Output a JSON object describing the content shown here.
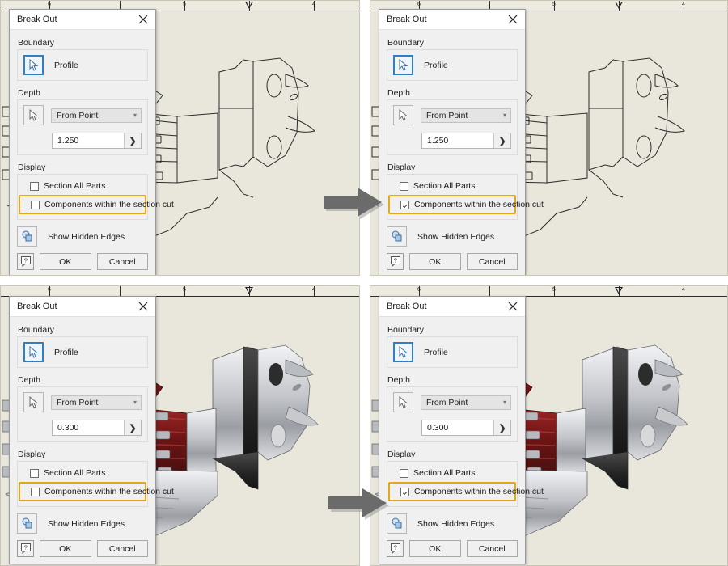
{
  "app": {
    "dialog_title": "Break Out",
    "close_icon": "close-icon"
  },
  "ruler": {
    "labels": [
      "6",
      "5",
      "4"
    ],
    "marker_icon": "down-triangle-marker"
  },
  "dialog": {
    "boundary": {
      "group_label": "Boundary",
      "profile_label": "Profile",
      "profile_icon": "select-arrow-icon"
    },
    "depth": {
      "group_label": "Depth",
      "point_icon": "select-arrow-icon",
      "method_value": "From Point",
      "chevron_icon": "chevron-down-icon",
      "spin_icon": "spinner-more-icon"
    },
    "display": {
      "group_label": "Display",
      "section_all_parts_label": "Section All Parts",
      "components_label": "Components within the section cut",
      "hidden_edges_label": "Show Hidden Edges",
      "hidden_edges_icon": "show-hidden-edges-icon"
    },
    "footer": {
      "help_label": "?",
      "help_icon": "help-icon",
      "ok_label": "OK",
      "cancel_label": "Cancel"
    }
  },
  "panels": [
    {
      "id": "top-left",
      "position": "top-left",
      "depth_value": "1.250",
      "section_all_parts_checked": false,
      "components_checked": false,
      "view_mode": "wireframe",
      "highlight_color": "#e3a81a"
    },
    {
      "id": "top-right",
      "position": "top-right",
      "depth_value": "1.250",
      "section_all_parts_checked": false,
      "components_checked": true,
      "view_mode": "wireframe",
      "highlight_color": "#e3a81a"
    },
    {
      "id": "bottom-left",
      "position": "bottom-left",
      "depth_value": "0.300",
      "section_all_parts_checked": false,
      "components_checked": false,
      "view_mode": "shaded",
      "highlight_color": "#e3a81a"
    },
    {
      "id": "bottom-right",
      "position": "bottom-right",
      "depth_value": "0.300",
      "section_all_parts_checked": false,
      "components_checked": true,
      "view_mode": "shaded",
      "highlight_color": "#e3a81a"
    }
  ],
  "colors": {
    "canvas_background": "#e9e7dc",
    "highlight": "#e3a81a",
    "arrow": "#6b6b6b",
    "dialog_background": "#f0f0f0",
    "titlebar_background": "#ffffff",
    "selected_border": "#2e7fc4",
    "part_red": "#8a1f1f",
    "part_dark": "#2a2a2a",
    "part_steel": "#c9cace"
  },
  "annotations": {
    "arrow_top_label": "",
    "arrow_bottom_label": ""
  }
}
